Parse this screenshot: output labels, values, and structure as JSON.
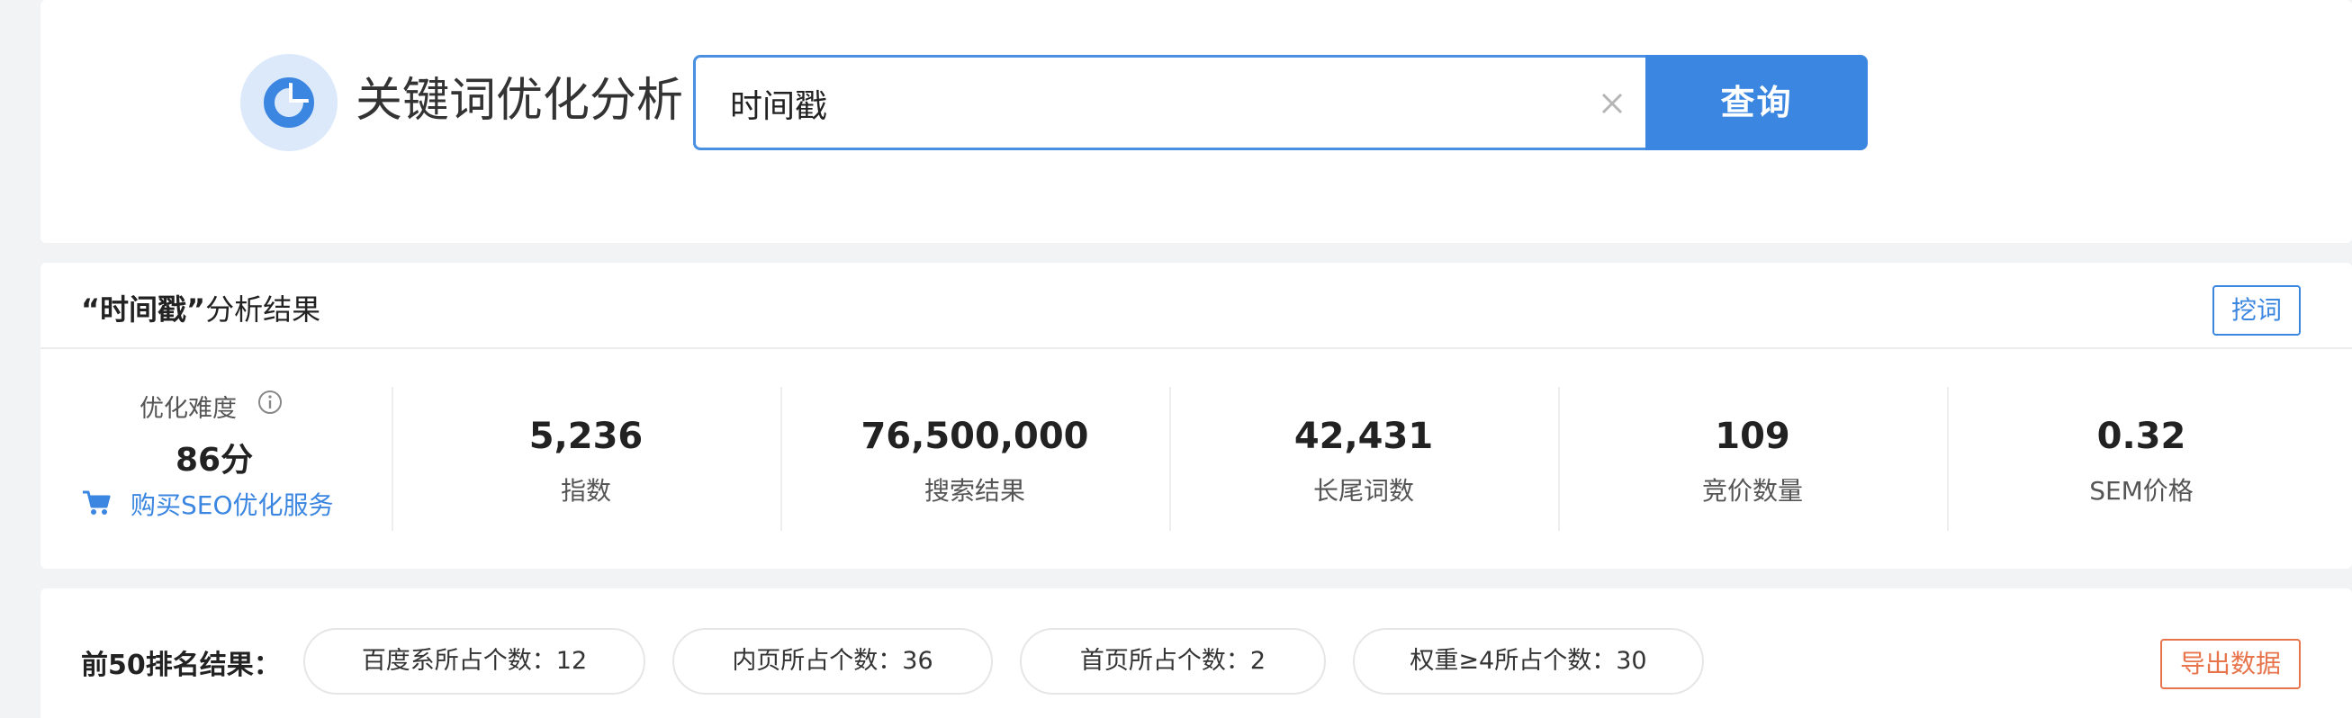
{
  "header": {
    "logo_icon": "pie-chart-icon",
    "title": "关键词优化分析",
    "search_value": "时间戳",
    "clear_icon": "close-icon",
    "query_label": "查询"
  },
  "analysis": {
    "keyword_quoted": "“时间戳”",
    "title_suffix": "分析结果",
    "dig_label": "挖词",
    "difficulty_label": "优化难度",
    "difficulty_info_icon": "info-icon",
    "difficulty_value": "86分",
    "buy_icon": "cart-icon",
    "buy_label": "购买SEO优化服务",
    "metrics": [
      {
        "value": "5,236",
        "label": "指数"
      },
      {
        "value": "76,500,000",
        "label": "搜索结果"
      },
      {
        "value": "42,431",
        "label": "长尾词数"
      },
      {
        "value": "109",
        "label": "竞价数量"
      },
      {
        "value": "0.32",
        "label": "SEM价格"
      }
    ]
  },
  "ranking": {
    "title": "前50排名结果：",
    "pills": [
      "百度系所占个数：12",
      "内页所占个数：36",
      "首页所占个数：2",
      "权重≥4所占个数：30"
    ],
    "export_label": "导出数据"
  },
  "colors": {
    "accent": "#3b86e0",
    "export": "#e8744c",
    "background": "#f2f3f5"
  }
}
